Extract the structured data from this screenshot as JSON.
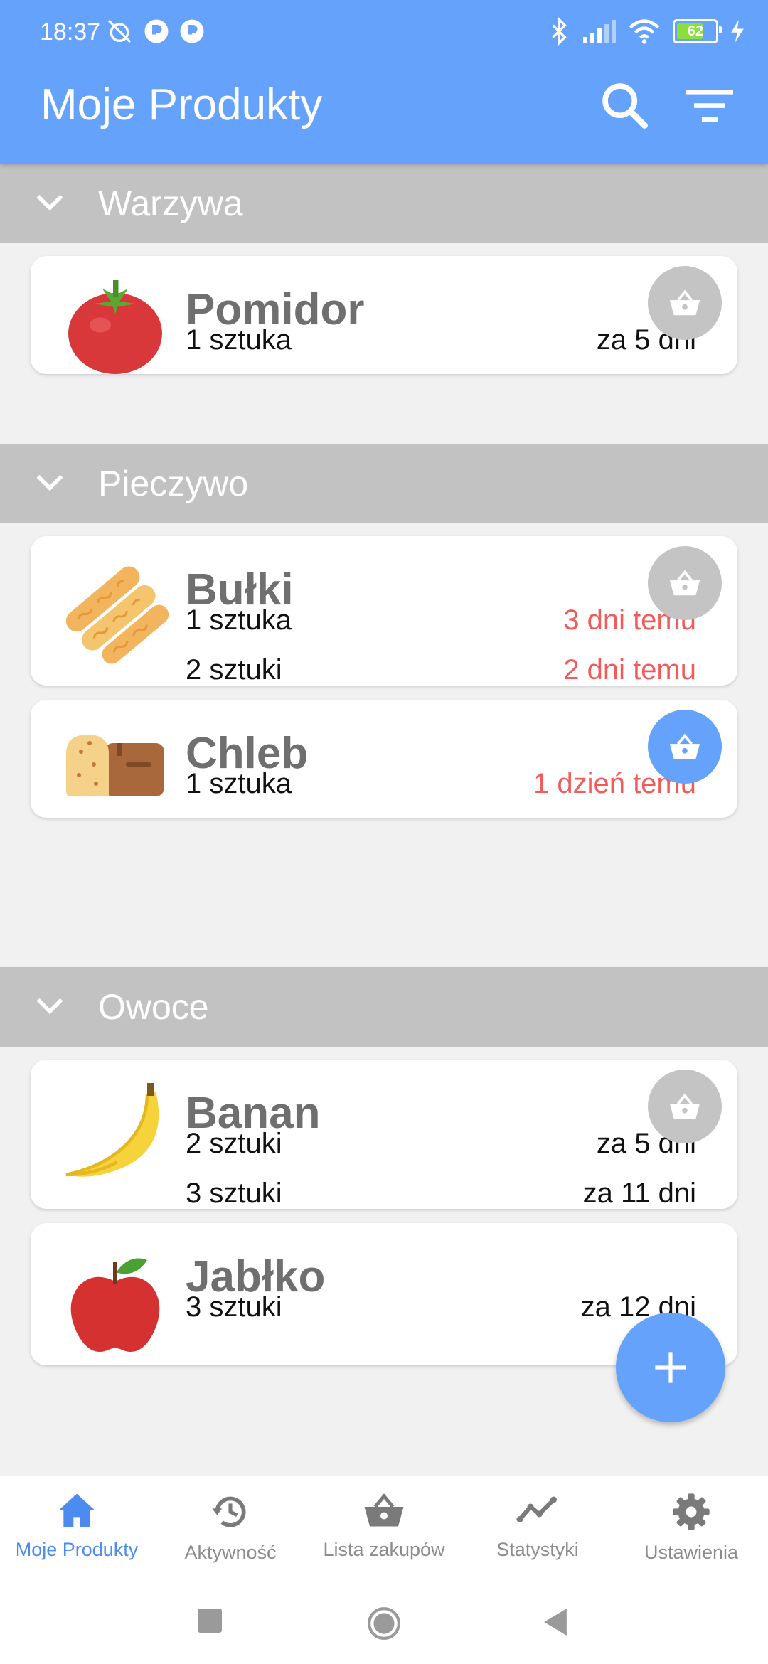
{
  "status_bar": {
    "time": "18:37",
    "battery": "62"
  },
  "app_bar": {
    "title": "Moje Produkty"
  },
  "sections": [
    {
      "label": "Warzywa",
      "products": [
        {
          "name": "Pomidor",
          "icon": "tomato-icon",
          "basket_active": false,
          "rows": [
            {
              "qty": "1 sztuka",
              "when": "za 5 dni",
              "overdue": false
            }
          ]
        }
      ]
    },
    {
      "label": "Pieczywo",
      "products": [
        {
          "name": "Bułki",
          "icon": "bread-rolls-icon",
          "basket_active": false,
          "rows": [
            {
              "qty": "1 sztuka",
              "when": "3 dni temu",
              "overdue": true
            },
            {
              "qty": "2 sztuki",
              "when": "2 dni temu",
              "overdue": true
            }
          ]
        },
        {
          "name": "Chleb",
          "icon": "bread-loaf-icon",
          "basket_active": true,
          "rows": [
            {
              "qty": "1 sztuka",
              "when": "1 dzień temu",
              "overdue": true
            }
          ]
        }
      ]
    },
    {
      "label": "Owoce",
      "products": [
        {
          "name": "Banan",
          "icon": "banana-icon",
          "basket_active": false,
          "rows": [
            {
              "qty": "2 sztuki",
              "when": "za 5 dni",
              "overdue": false
            },
            {
              "qty": "3 sztuki",
              "when": "za 11 dni",
              "overdue": false
            }
          ]
        },
        {
          "name": "Jabłko",
          "icon": "apple-icon",
          "basket_active": false,
          "rows": [
            {
              "qty": "3 sztuki",
              "when": "za 12 dni",
              "overdue": false
            }
          ]
        }
      ]
    }
  ],
  "bottom_nav": [
    {
      "label": "Moje Produkty",
      "icon": "home-icon",
      "active": true
    },
    {
      "label": "Aktywność",
      "icon": "history-icon",
      "active": false
    },
    {
      "label": "Lista zakupów",
      "icon": "basket-icon",
      "active": false
    },
    {
      "label": "Statystyki",
      "icon": "chart-icon",
      "active": false
    },
    {
      "label": "Ustawienia",
      "icon": "gear-icon",
      "active": false
    }
  ],
  "colors": {
    "primary": "#64a2fb",
    "overdue": "#f35b5b",
    "section_header": "#c2c2c2"
  }
}
